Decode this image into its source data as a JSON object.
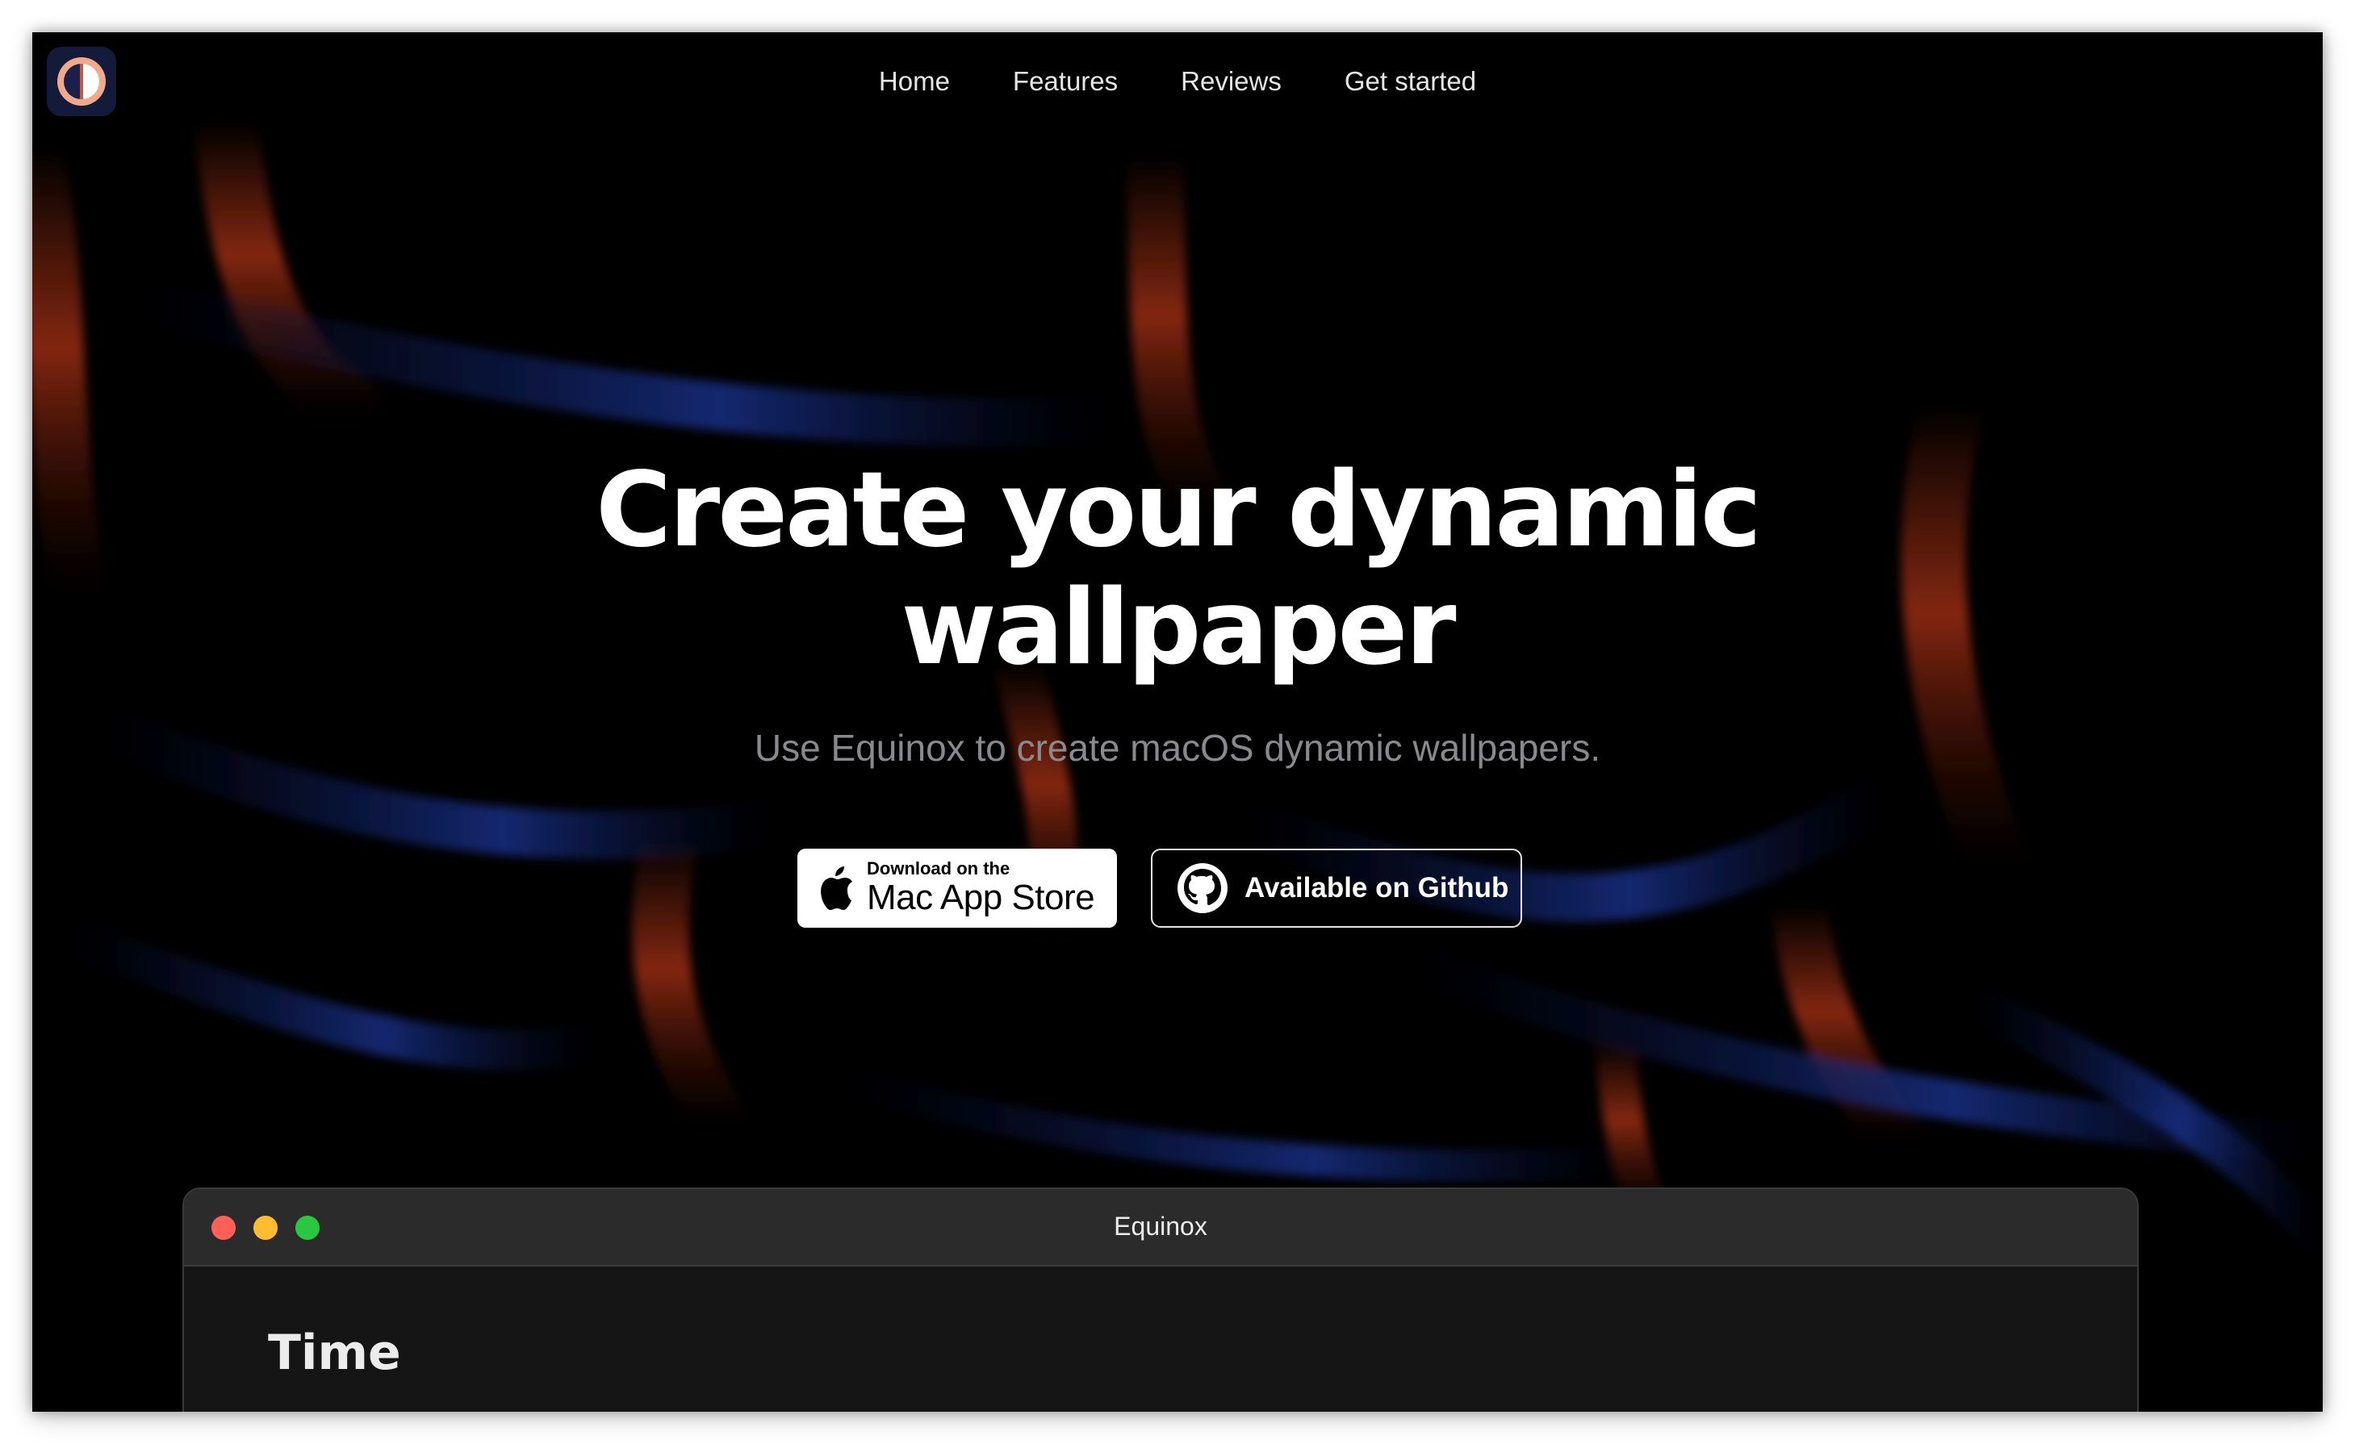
{
  "header": {
    "logo_icon": "equinox-logo-icon",
    "nav": [
      "Home",
      "Features",
      "Reviews",
      "Get started"
    ]
  },
  "hero": {
    "title_line1": "Create your dynamic",
    "title_line2": "wallpaper",
    "subtitle": "Use Equinox to create macOS dynamic wallpapers."
  },
  "buttons": {
    "appstore_small": "Download on the",
    "appstore_big": "Mac App Store",
    "appstore_icon": "apple-icon",
    "github_label": "Available on Github",
    "github_icon": "github-icon"
  },
  "app_window": {
    "title": "Equinox",
    "section_heading": "Time"
  },
  "colors": {
    "background": "#000000",
    "text": "#ffffff",
    "subtitle": "#8a8a8e",
    "accent_red": "#c23a18",
    "accent_blue": "#1f3fb0"
  }
}
